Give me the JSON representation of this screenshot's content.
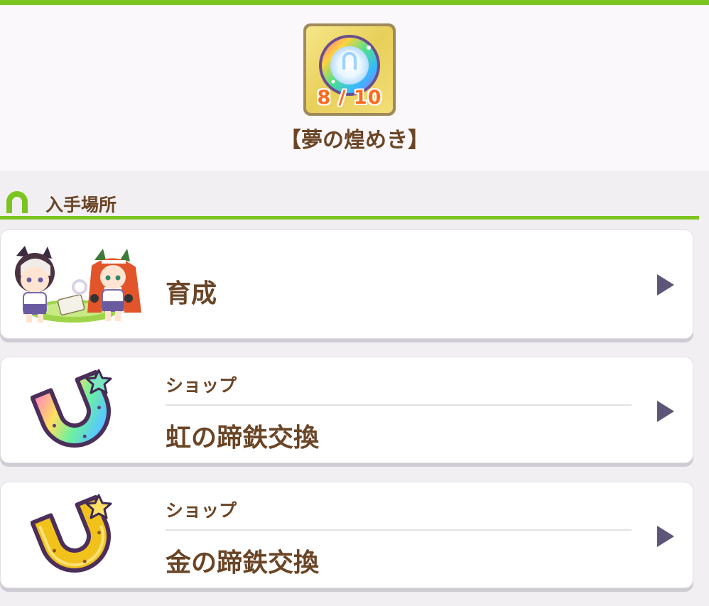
{
  "item": {
    "count": "8 / 10",
    "title": "【夢の煌めき】"
  },
  "section": {
    "label": "入手場所"
  },
  "sources": [
    {
      "title": "育成"
    },
    {
      "category": "ショップ",
      "title": "虹の蹄鉄交換"
    },
    {
      "category": "ショップ",
      "title": "金の蹄鉄交換"
    }
  ],
  "colors": {
    "accent_green": "#7cc520",
    "text_brown": "#6a4526",
    "count_orange": "#ff6a1a",
    "arrow_purple": "#5e5679"
  },
  "icons": {
    "item": "rainbow-horseshoe-orb-icon",
    "section": "horseshoe-icon",
    "source_training": "training-characters-illustration",
    "source_rainbow": "rainbow-horseshoe-icon",
    "source_gold": "gold-horseshoe-icon",
    "arrow": "chevron-right-icon"
  }
}
